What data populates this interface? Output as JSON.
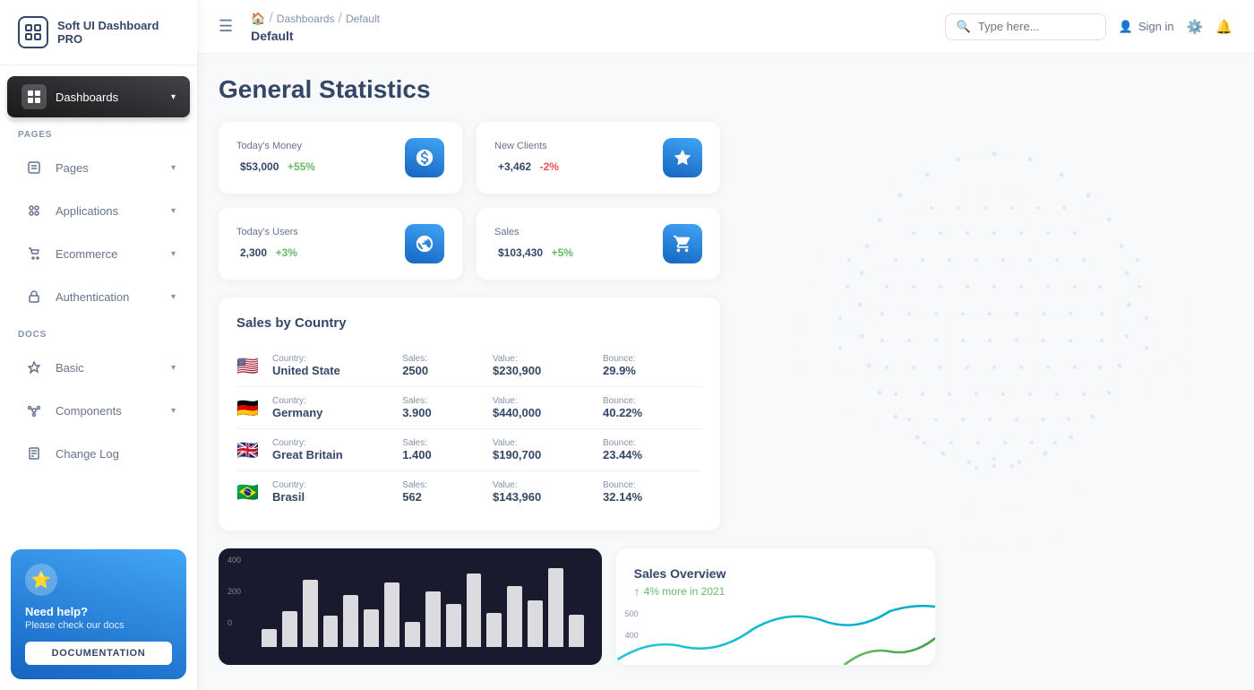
{
  "app": {
    "name": "Soft UI Dashboard PRO"
  },
  "breadcrumb": {
    "home": "🏠",
    "dashboards": "Dashboards",
    "current": "Default"
  },
  "topbar": {
    "search_placeholder": "Type here...",
    "signin_label": "Sign in",
    "hamburger": "☰"
  },
  "sidebar": {
    "section_pages": "PAGES",
    "section_docs": "DOCS",
    "items": [
      {
        "id": "dashboards",
        "label": "Dashboards",
        "icon": "dashboard",
        "active": true
      },
      {
        "id": "pages",
        "label": "Pages",
        "icon": "pages"
      },
      {
        "id": "applications",
        "label": "Applications",
        "icon": "applications"
      },
      {
        "id": "ecommerce",
        "label": "Ecommerce",
        "icon": "ecommerce"
      },
      {
        "id": "authentication",
        "label": "Authentication",
        "icon": "auth"
      },
      {
        "id": "basic",
        "label": "Basic",
        "icon": "basic"
      },
      {
        "id": "components",
        "label": "Components",
        "icon": "components"
      },
      {
        "id": "changelog",
        "label": "Change Log",
        "icon": "changelog"
      }
    ],
    "help": {
      "title": "Need help?",
      "subtitle": "Please check our docs",
      "button": "DOCUMENTATION"
    }
  },
  "page_title": "General Statistics",
  "stats": [
    {
      "label": "Today's Money",
      "value": "$53,000",
      "change": "+55%",
      "change_type": "pos",
      "icon": "$"
    },
    {
      "label": "New Clients",
      "value": "+3,462",
      "change": "-2%",
      "change_type": "neg",
      "icon": "🏆"
    },
    {
      "label": "Today's Users",
      "value": "2,300",
      "change": "+3%",
      "change_type": "pos",
      "icon": "🌐"
    },
    {
      "label": "Sales",
      "value": "$103,430",
      "change": "+5%",
      "change_type": "pos",
      "icon": "🛒"
    }
  ],
  "sales_by_country": {
    "title": "Sales by Country",
    "columns": [
      "Country:",
      "Sales:",
      "Value:",
      "Bounce:"
    ],
    "rows": [
      {
        "flag": "🇺🇸",
        "country": "United State",
        "sales": "2500",
        "value": "$230,900",
        "bounce": "29.9%"
      },
      {
        "flag": "🇩🇪",
        "country": "Germany",
        "sales": "3.900",
        "value": "$440,000",
        "bounce": "40.22%"
      },
      {
        "flag": "🇬🇧",
        "country": "Great Britain",
        "sales": "1.400",
        "value": "$190,700",
        "bounce": "23.44%"
      },
      {
        "flag": "🇧🇷",
        "country": "Brasil",
        "sales": "562",
        "value": "$143,960",
        "bounce": "32.14%"
      }
    ]
  },
  "bar_chart": {
    "y_labels": [
      "400",
      "200",
      "0"
    ],
    "bars": [
      20,
      40,
      80,
      35,
      60,
      45,
      75,
      30,
      65,
      50,
      85,
      40,
      70,
      55,
      90,
      38
    ]
  },
  "sales_overview": {
    "title": "Sales Overview",
    "subtitle": "4% more in 2021",
    "y_labels": [
      "500",
      "400"
    ]
  }
}
